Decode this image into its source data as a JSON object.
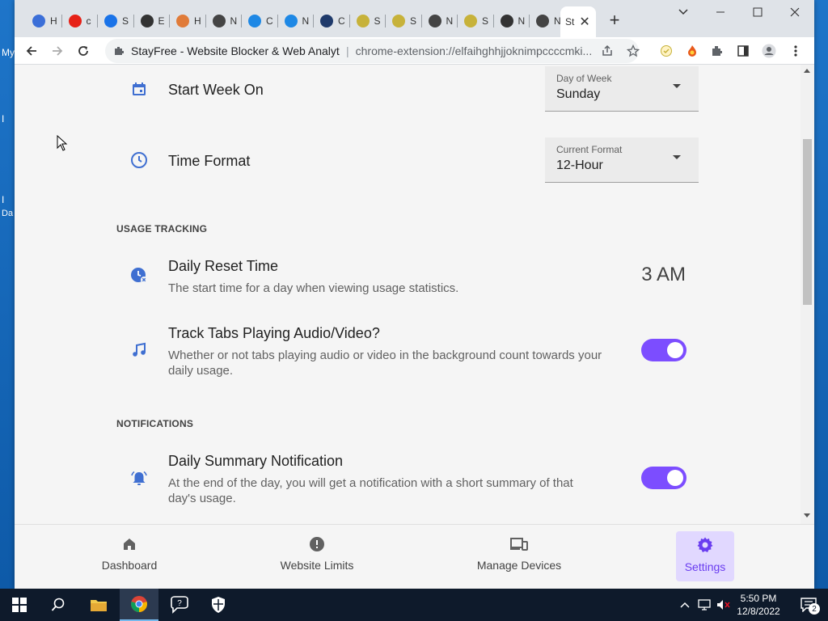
{
  "desktop": {
    "labels": [
      "My",
      "Da"
    ]
  },
  "browser": {
    "tabs": [
      {
        "label": "H",
        "icon": "history-icon",
        "color": "#3b6fd8"
      },
      {
        "label": "c",
        "icon": "youtube-icon",
        "color": "#e62117"
      },
      {
        "label": "S",
        "icon": "gear-icon",
        "color": "#1a73e8"
      },
      {
        "label": "E",
        "icon": "globe-icon",
        "color": "#333333"
      },
      {
        "label": "H",
        "icon": "rainbow-icon",
        "color": "#e07b39"
      },
      {
        "label": "N",
        "icon": "chrome-icon",
        "color": "#444444"
      },
      {
        "label": "C",
        "icon": "edge-icon",
        "color": "#1e88e5"
      },
      {
        "label": "N",
        "icon": "edge-icon",
        "color": "#1e88e5"
      },
      {
        "label": "C",
        "icon": "shield-icon",
        "color": "#1f3a6b"
      },
      {
        "label": "S",
        "icon": "stayfree-icon",
        "color": "#c7b23a"
      },
      {
        "label": "S",
        "icon": "stayfree-icon",
        "color": "#c7b23a"
      },
      {
        "label": "N",
        "icon": "chrome-icon",
        "color": "#444444"
      },
      {
        "label": "S",
        "icon": "stayfree-icon",
        "color": "#c7b23a"
      },
      {
        "label": "N",
        "icon": "globe-icon",
        "color": "#333333"
      },
      {
        "label": "N",
        "icon": "chrome-icon",
        "color": "#444444"
      }
    ],
    "active_tab_label": "St",
    "omnibox": {
      "site_name": "StayFree - Website Blocker & Web Analyt",
      "url": "chrome-extension://elfaihghhjjoknimpccccmki..."
    }
  },
  "settings": {
    "start_week": {
      "title": "Start Week On",
      "select_label": "Day of Week",
      "value": "Sunday"
    },
    "time_format": {
      "title": "Time Format",
      "select_label": "Current Format",
      "value": "12-Hour"
    },
    "usage_section": "USAGE TRACKING",
    "daily_reset": {
      "title": "Daily Reset Time",
      "desc": "The start time for a day when viewing usage statistics.",
      "value": "3 AM"
    },
    "track_tabs": {
      "title": "Track Tabs Playing Audio/Video?",
      "desc": "Whether or not tabs playing audio or video in the background count towards your daily usage.",
      "enabled": true
    },
    "notifications_section": "NOTIFICATIONS",
    "daily_summary": {
      "title": "Daily Summary Notification",
      "desc": "At the end of the day, you will get a notification with a short summary of that day's usage.",
      "enabled": true
    }
  },
  "bottom_nav": [
    {
      "label": "Dashboard",
      "icon": "home-icon",
      "active": false
    },
    {
      "label": "Website Limits",
      "icon": "alert-icon",
      "active": false
    },
    {
      "label": "Manage Devices",
      "icon": "devices-icon",
      "active": false
    },
    {
      "label": "Settings",
      "icon": "gear-icon",
      "active": true
    }
  ],
  "colors": {
    "accent": "#7c4dff",
    "icon_blue": "#3f6fd1",
    "active_nav_bg": "#e1d8ff"
  },
  "taskbar": {
    "time": "5:50 PM",
    "date": "12/8/2022",
    "notification_count": "2"
  }
}
